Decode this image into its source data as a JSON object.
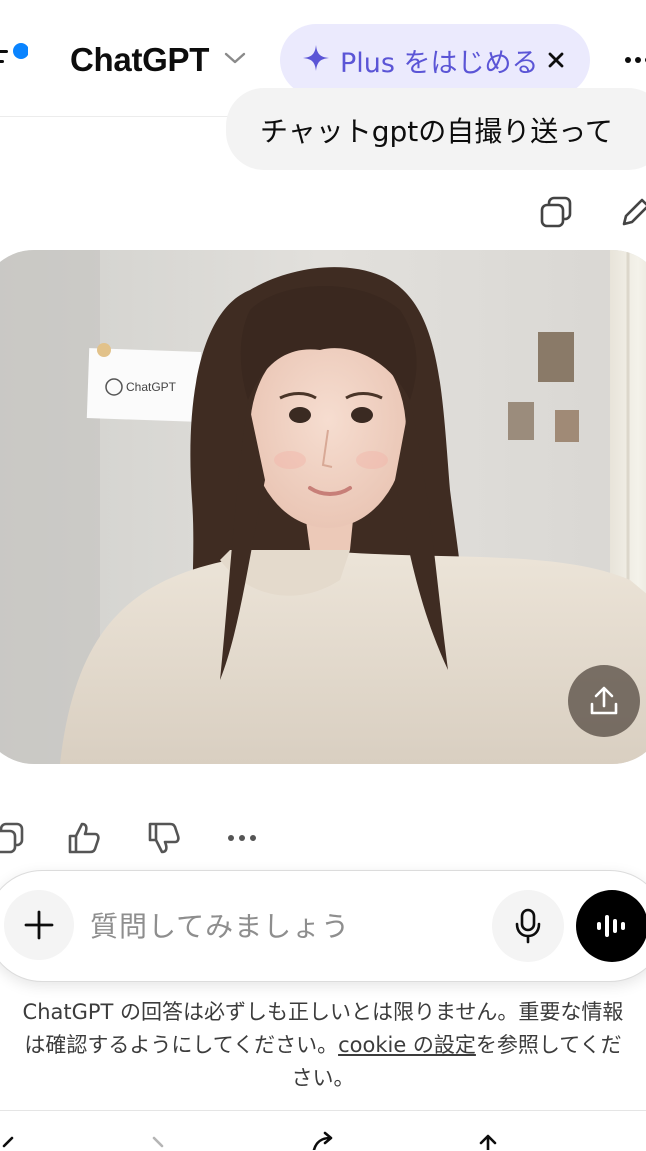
{
  "header": {
    "title": "ChatGPT",
    "upgrade_label": "Plus をはじめる",
    "accent_color": "#5b55d6",
    "notification_dot_color": "#0a84ff"
  },
  "conversation": {
    "user_message": "チャットgptの自撮り送って",
    "image": {
      "wall_note_text": "ChatGPT"
    }
  },
  "composer": {
    "placeholder": "質問してみましょう"
  },
  "footer": {
    "disclaimer_line1": "ChatGPT の回答は必ずしも正しいとは限りません。重要な情報",
    "disclaimer_line2_pre": "は確認するようにしてください。",
    "disclaimer_link": "cookie の設定",
    "disclaimer_line2_post": "を参照してくだ",
    "disclaimer_line3": "さい。"
  }
}
